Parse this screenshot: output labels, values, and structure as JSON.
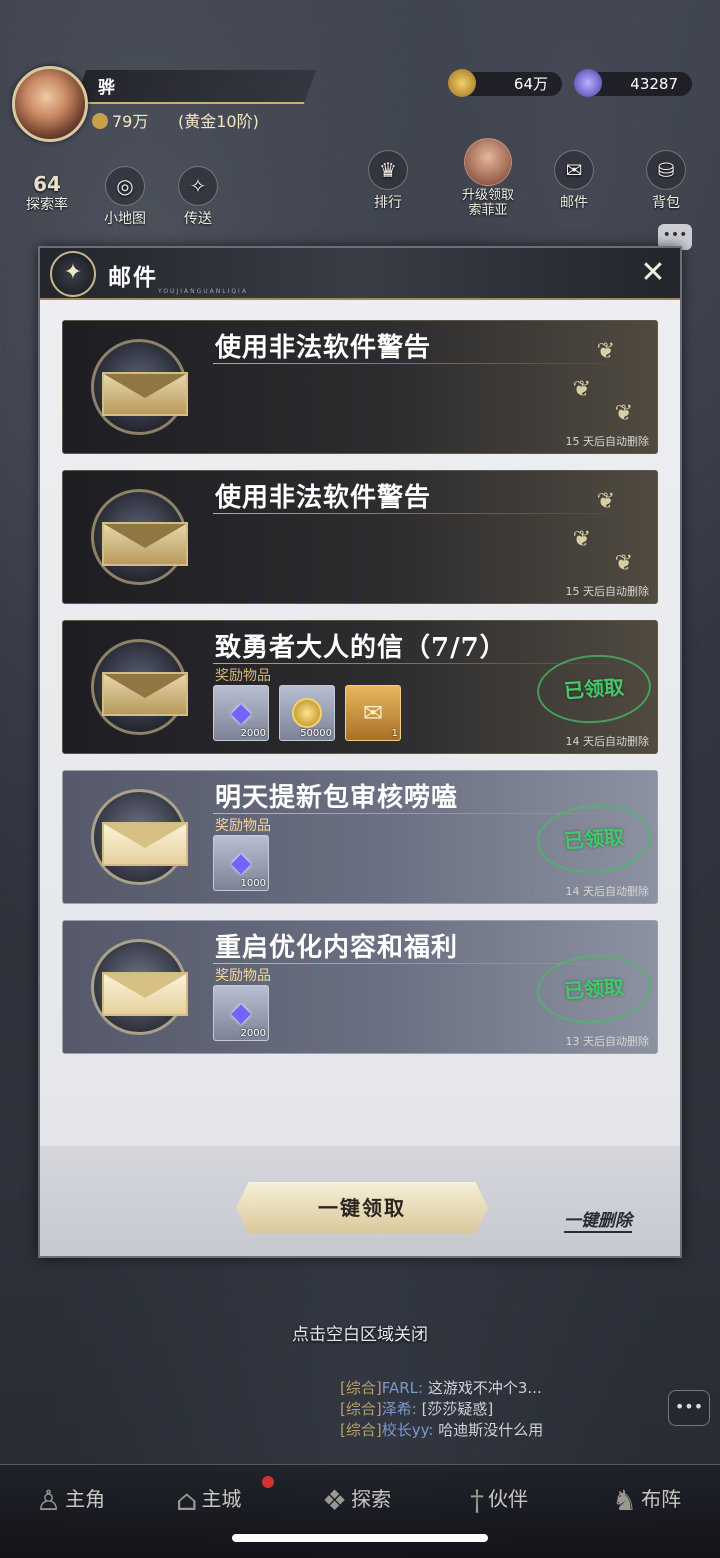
{
  "hud": {
    "player_name": "骅",
    "power": "79万",
    "rank": "(黄金10阶)",
    "gold": "64万",
    "gems": "43287",
    "explore_count": "64",
    "explore_label": "探索率",
    "map_label": "小地图",
    "teleport_label": "传送",
    "rank_label": "排行",
    "upgrade_label_line1": "升级领取",
    "upgrade_label_line2": "索菲亚",
    "mail_label": "邮件",
    "bag_label": "背包"
  },
  "mail_panel": {
    "title": "邮件",
    "subtitle": "YOUJIANGUANLIQIA",
    "reward_label": "奖励物品",
    "claimed_stamp": "已领取",
    "claim_all": "一键领取",
    "delete_all": "一键删除",
    "mails": [
      {
        "title": "使用非法软件警告",
        "expire": "15 天后自动删除",
        "style": "dark",
        "items": [],
        "claimed": false
      },
      {
        "title": "使用非法软件警告",
        "expire": "15 天后自动删除",
        "style": "dark",
        "items": [],
        "claimed": false
      },
      {
        "title": "致勇者大人的信（7/7）",
        "expire": "14 天后自动删除",
        "style": "dark",
        "items": [
          {
            "type": "gem",
            "qty": "2000"
          },
          {
            "type": "coin",
            "qty": "50000"
          },
          {
            "type": "scroll",
            "qty": "1"
          }
        ],
        "claimed": true
      },
      {
        "title": "明天提新包审核唠嗑",
        "expire": "14 天后自动删除",
        "style": "light",
        "items": [
          {
            "type": "gem",
            "qty": "1000"
          }
        ],
        "claimed": true
      },
      {
        "title": "重启优化内容和福利",
        "expire": "13 天后自动删除",
        "style": "light",
        "items": [
          {
            "type": "gem",
            "qty": "2000"
          }
        ],
        "claimed": true
      }
    ]
  },
  "close_hint": "点击空白区域关闭",
  "chat": [
    {
      "channel": "[综合]",
      "who": "FARL:",
      "text": "这游戏不冲个3..."
    },
    {
      "channel": "[综合]",
      "who": "泽希:",
      "text": "[莎莎疑惑]"
    },
    {
      "channel": "[综合]",
      "who": "校长yy:",
      "text": "哈迪斯没什么用"
    }
  ],
  "nav": {
    "hero": "主角",
    "city": "主城",
    "explore": "探索",
    "partner": "伙伴",
    "formation": "布阵"
  }
}
